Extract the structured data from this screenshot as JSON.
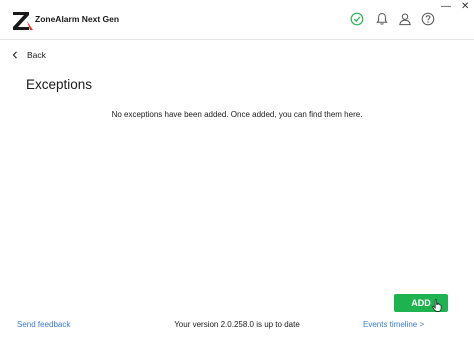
{
  "app": {
    "title": "ZoneAlarm Next Gen",
    "logo_icon": "zonealarm-logo-icon"
  },
  "header": {
    "icons": [
      "status-ok-icon",
      "bell-icon",
      "user-icon",
      "help-icon"
    ],
    "status_color": "#2bb35a"
  },
  "window_controls": {
    "minimize": "—",
    "close": "✕"
  },
  "nav": {
    "back_label": "Back"
  },
  "page": {
    "title": "Exceptions",
    "empty_message": "No exceptions have been added. Once added, you can find them here."
  },
  "actions": {
    "add_label": "ADD",
    "add_color": "#1db34f"
  },
  "footer": {
    "feedback_label": "Send feedback",
    "version_status": "Your version 2.0.258.0 is up to date",
    "timeline_label": "Events timeline >"
  }
}
